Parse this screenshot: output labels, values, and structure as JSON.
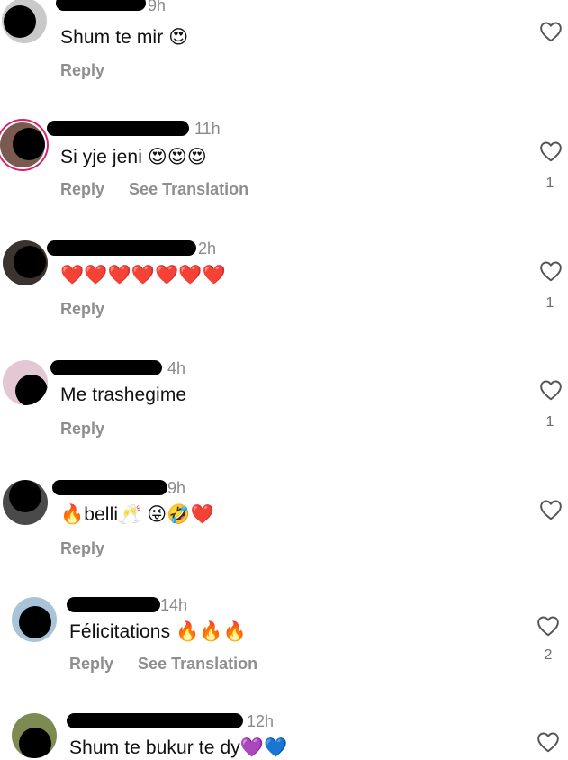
{
  "labels": {
    "reply": "Reply",
    "see_translation": "See Translation"
  },
  "comments": [
    {
      "time": "9h",
      "text": "Shum te mir 😍",
      "count": ""
    },
    {
      "time": "11h",
      "text": "Si yje jeni 😍😍😍",
      "count": "1"
    },
    {
      "time": "2h",
      "text": "❤️❤️❤️❤️❤️❤️❤️",
      "count": "1"
    },
    {
      "time": "4h",
      "text": "Me trashegime",
      "count": "1"
    },
    {
      "time": "9h",
      "text": "🔥belli🥂 😜🤣❤️",
      "count": ""
    },
    {
      "time": "14h",
      "text": "Félicitations 🔥🔥🔥",
      "count": "2"
    },
    {
      "time": "12h",
      "text": "Shum te bukur te dy💜💙",
      "count": ""
    }
  ],
  "icons": {
    "like": "heart-outline-icon"
  },
  "colors": {
    "muted_text": "#8e8e8e",
    "story_ring": "#d6246e"
  }
}
